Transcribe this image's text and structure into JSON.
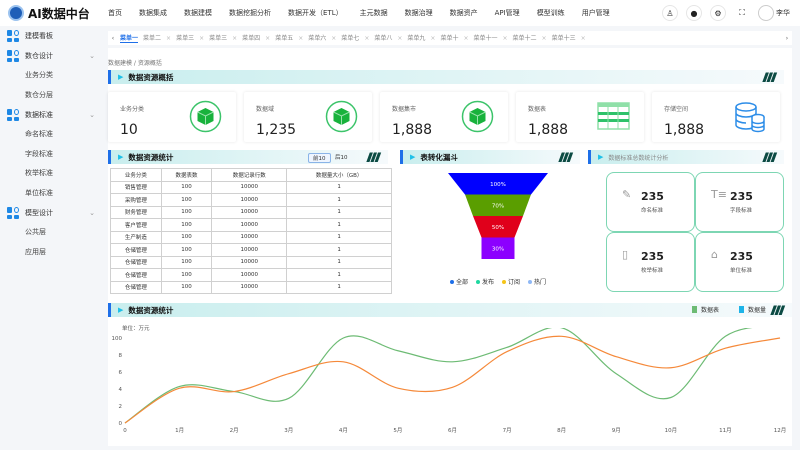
{
  "header": {
    "logo": "AI数据中台",
    "nav": [
      "首页",
      "数据集成",
      "数据建模",
      "数据挖掘分析",
      "数据开发（ETL）",
      "主元数据",
      "数据治理",
      "数据资产",
      "API管理",
      "模型训练",
      "用户管理"
    ],
    "user": "李华",
    "icons": [
      "user-icon",
      "bell-icon",
      "gear-icon",
      "fullscreen-icon"
    ]
  },
  "sidebar": [
    {
      "label": "建模看板",
      "items": []
    },
    {
      "label": "数仓设计",
      "items": [
        "业务分类",
        "数仓分层"
      ]
    },
    {
      "label": "数据标准",
      "items": [
        "命名标准",
        "字段标准",
        "枚举标准",
        "单位标准"
      ]
    },
    {
      "label": "模型设计",
      "items": [
        "公共层",
        "应用层"
      ]
    }
  ],
  "tabs": [
    "菜单一",
    "菜单二",
    "菜单三",
    "菜单三",
    "菜单四",
    "菜单五",
    "菜单六",
    "菜单七",
    "菜单八",
    "菜单九",
    "菜单十",
    "菜单十一",
    "菜单十二",
    "菜单十三"
  ],
  "breadcrumb": "数据建模 / 资源概括",
  "overview": {
    "title": "数据资源概括",
    "cards": [
      {
        "label": "业务分类",
        "value": "10",
        "icon": "cube-icon"
      },
      {
        "label": "数据域",
        "value": "1,235",
        "icon": "cube-icon"
      },
      {
        "label": "数据集市",
        "value": "1,888",
        "icon": "cube-icon"
      },
      {
        "label": "数据表",
        "value": "1,888",
        "icon": "table-icon"
      },
      {
        "label": "存储空间",
        "value": "1,888",
        "icon": "database-icon"
      }
    ]
  },
  "resource_table": {
    "title": "数据资源统计",
    "prev": "前10",
    "next": "后10",
    "columns": [
      "业务分类",
      "数据表数",
      "数据记录行数",
      "数据量大小（GB）"
    ],
    "rows": [
      [
        "销售管理",
        "100",
        "10000",
        "1"
      ],
      [
        "采购管理",
        "100",
        "10000",
        "1"
      ],
      [
        "财务管理",
        "100",
        "10000",
        "1"
      ],
      [
        "客户管理",
        "100",
        "10000",
        "1"
      ],
      [
        "生产制造",
        "100",
        "10000",
        "1"
      ],
      [
        "仓储管理",
        "100",
        "10000",
        "1"
      ],
      [
        "仓储管理",
        "100",
        "10000",
        "1"
      ],
      [
        "仓储管理",
        "100",
        "10000",
        "1"
      ],
      [
        "仓储管理",
        "100",
        "10000",
        "1"
      ]
    ]
  },
  "funnel": {
    "title": "表转化漏斗",
    "stages": [
      {
        "label": "100%",
        "color": "#0000ff"
      },
      {
        "label": "70%",
        "color": "#5a9e00"
      },
      {
        "label": "50%",
        "color": "#e0001b"
      },
      {
        "label": "30%",
        "color": "#8c00ff"
      }
    ],
    "legend": [
      {
        "name": "全部",
        "color": "#1e6fe8"
      },
      {
        "name": "发布",
        "color": "#1ed8a0"
      },
      {
        "name": "订阅",
        "color": "#f5c518"
      },
      {
        "name": "热门",
        "color": "#8fb8f5"
      }
    ]
  },
  "standards": {
    "title": "数据标准总数统计分析",
    "items": [
      {
        "value": "235",
        "label": "命名标准",
        "icon": "pencil-icon"
      },
      {
        "value": "235",
        "label": "字段标准",
        "icon": "text-icon"
      },
      {
        "value": "235",
        "label": "枚举标准",
        "icon": "enum-icon"
      },
      {
        "value": "235",
        "label": "单位标准",
        "icon": "unit-icon"
      }
    ]
  },
  "chart_data": {
    "type": "line",
    "title": "数据资源统计",
    "ylabel": "单位：万元",
    "x": [
      "0",
      "1月",
      "2月",
      "3月",
      "4月",
      "5月",
      "6月",
      "7月",
      "8月",
      "9月",
      "10月",
      "11月",
      "12月"
    ],
    "yticks": [
      "0",
      "2",
      "4",
      "6",
      "8",
      "100"
    ],
    "ylim": [
      0,
      10
    ],
    "legend_placement": "top-right",
    "series": [
      {
        "name": "数据表",
        "color": "#6dbb74",
        "values": [
          0,
          4.3,
          3.7,
          2.9,
          10,
          8.5,
          7.2,
          8.9,
          11.2,
          5.8,
          3,
          10.2,
          11.5
        ]
      },
      {
        "name": "数据量",
        "color": "#f5893a",
        "legend_color": "#1eb4e8",
        "values": [
          0,
          4.1,
          3.7,
          5.8,
          7.2,
          4.1,
          4.2,
          8.4,
          10.2,
          7.8,
          6.5,
          8.8,
          10
        ]
      }
    ]
  }
}
